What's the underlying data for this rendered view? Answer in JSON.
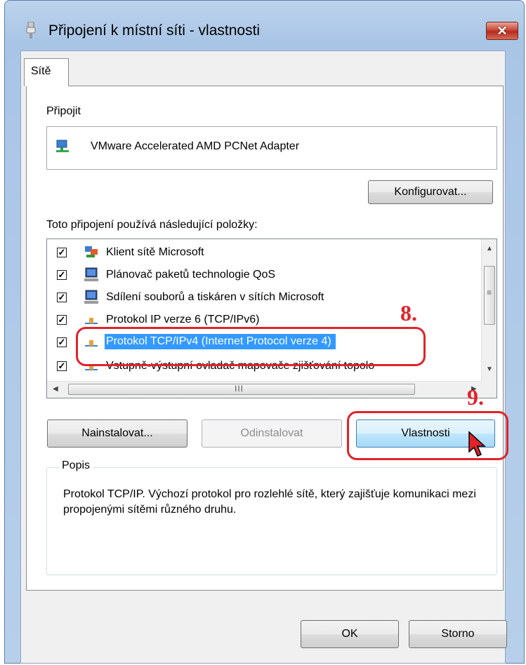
{
  "window": {
    "title": "Připojení k místní síti - vlastnosti",
    "close_glyph": "✕",
    "title_icon": "network-plug-icon"
  },
  "tab": {
    "label": "Sítě"
  },
  "connect": {
    "label": "Připojit",
    "adapter_name": "VMware Accelerated AMD PCNet Adapter",
    "adapter_icon": "network-adapter-icon",
    "configure_button": "Konfigurovat..."
  },
  "items": {
    "label": "Toto připojení používá následující položky:",
    "list": [
      {
        "label": "Klient sítě Microsoft",
        "checked": true,
        "icon": "network-client-icon"
      },
      {
        "label": "Plánovač paketů technologie QoS",
        "checked": true,
        "icon": "computer-service-icon"
      },
      {
        "label": "Sdílení souborů a tiskáren v sítích Microsoft",
        "checked": true,
        "icon": "computer-service-icon"
      },
      {
        "label": "Protokol IP verze 6 (TCP/IPv6)",
        "checked": true,
        "icon": "protocol-icon"
      },
      {
        "label": "Protokol TCP/IPv4 (Internet Protocol verze 4)",
        "checked": true,
        "icon": "protocol-icon",
        "selected": true
      },
      {
        "label": "Vstupně-výstupní ovladač mapovače zjišťování topolo",
        "checked": true,
        "icon": "protocol-icon"
      }
    ],
    "scroll_grip": "III",
    "vscroll_grip": "≡"
  },
  "buttons": {
    "install": "Nainstalovat...",
    "uninstall": "Odinstalovat",
    "properties": "Vlastnosti",
    "ok": "OK",
    "cancel": "Storno"
  },
  "description": {
    "title": "Popis",
    "text": "Protokol TCP/IP. Výchozí protokol pro rozlehlé sítě, který zajišťuje komunikaci mezi propojenými sítěmi různého druhu."
  },
  "annotations": {
    "step8": "8.",
    "step9": "9.",
    "color": "#e0232a"
  },
  "colors": {
    "selection": "#3399ff",
    "frame": "#a9c5e6"
  }
}
